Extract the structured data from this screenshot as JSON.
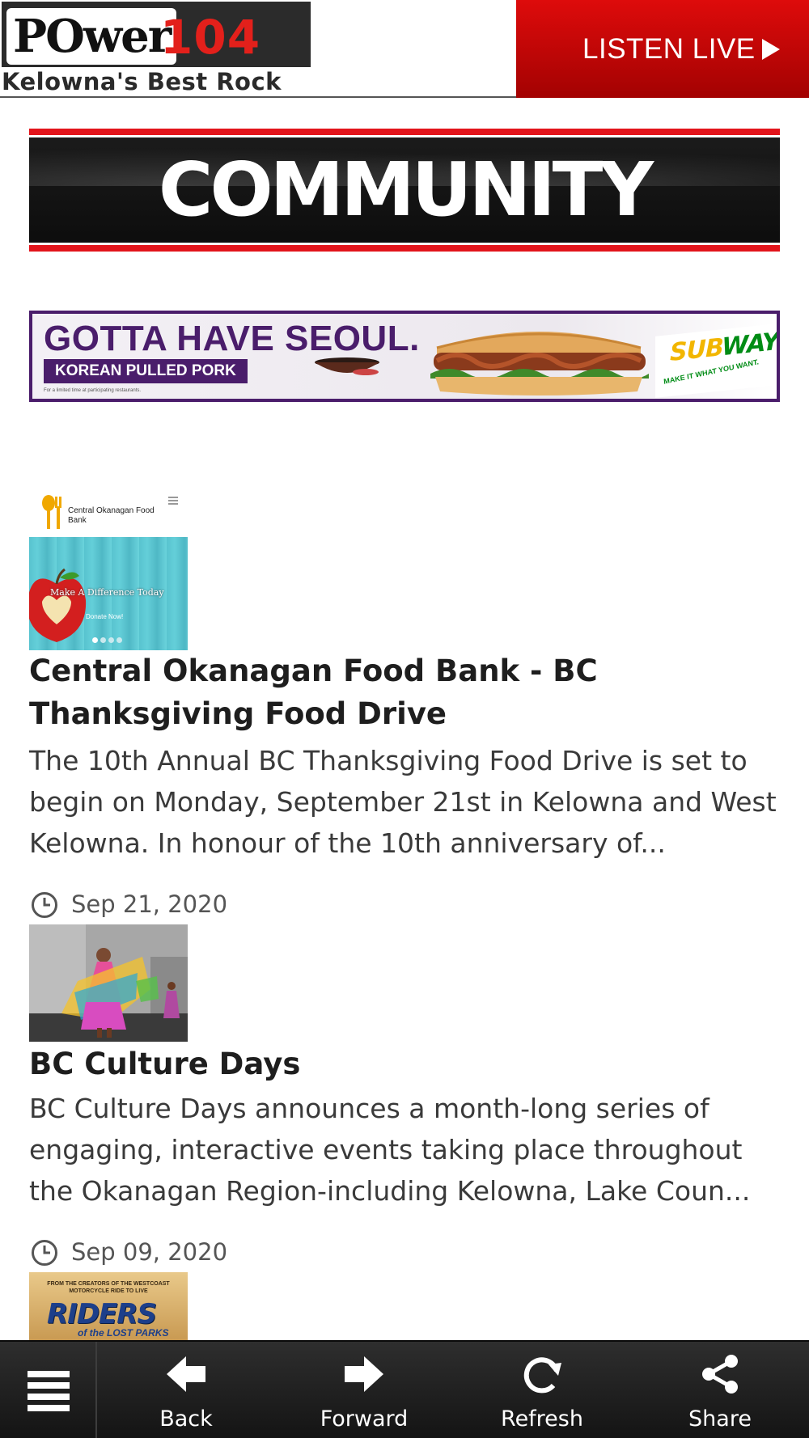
{
  "header": {
    "logo_word": "POwer",
    "logo_number": "104",
    "logo_tagline": "Kelowna's Best Rock",
    "listen_live_label": "LISTEN LIVE"
  },
  "community_banner": {
    "title": "COMMUNITY"
  },
  "ad": {
    "headline": "GOTTA HAVE SEOUL.",
    "subline": "KOREAN PULLED PORK",
    "fine_print": "For a limited time at participating restaurants.",
    "brand_sub": "SUB",
    "brand_way": "WAY",
    "brand_tagline": "MAKE IT WHAT YOU WANT."
  },
  "articles": [
    {
      "thumb_label": "Central Okanagan Food Bank",
      "thumb_caption": "Make A Difference Today",
      "thumb_button": "Donate Now!",
      "title": "Central Okanagan Food Bank - BC Thanksgiving Food Drive",
      "summary": "The 10th Annual BC Thanksgiving Food Drive is set to begin on Monday, September 21st in Kelowna and West Kelowna. In honour of the 10th anniversary of...",
      "date": "Sep 21, 2020"
    },
    {
      "title": "BC Culture Days",
      "summary": "BC Culture Days announces a month-long series of engaging, interactive events taking place throughout the Okanagan Region-including Kelowna, Lake Coun...",
      "date": "Sep 09, 2020"
    },
    {
      "thumb_top_text": "FROM THE CREATORS OF THE WESTCOAST MOTORCYCLE RIDE TO LIVE",
      "thumb_title": "RIDERS",
      "thumb_subtitle": "of the LOST PARKS"
    }
  ],
  "bottom_nav": {
    "back_label": "Back",
    "forward_label": "Forward",
    "refresh_label": "Refresh",
    "share_label": "Share"
  },
  "colors": {
    "listen_live_red": "#de0b0b",
    "ad_purple": "#4a1d6b",
    "nav_bg": "#1f1f1f"
  }
}
